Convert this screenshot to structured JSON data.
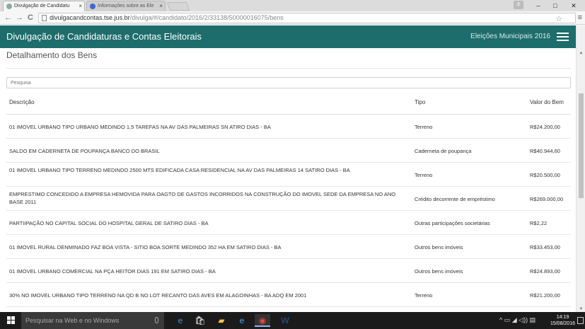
{
  "browser": {
    "tabs": [
      {
        "title": "Divulgação de Candidatu",
        "state": "active",
        "favicon_color": "#8aa"
      },
      {
        "title": "Informações sobre as Ele",
        "state": "inactive",
        "favicon_color": "#3b6cc7"
      }
    ],
    "url_host": "divulgacandcontas.tse.jus.br",
    "url_path": "/divulga/#/candidato/2016/2/33138/50000016075/bens",
    "back_glyph": "←",
    "forward_glyph": "→",
    "reload_glyph": "C",
    "star_glyph": "☆",
    "menu_glyph": "≡",
    "profile_glyph": "≗",
    "minimize_glyph": "–",
    "maximize_glyph": "□",
    "close_glyph": "✕"
  },
  "app": {
    "title": "Divulgação de Candidaturas e Contas Eleitorais",
    "election": "Eleições Municipais 2016",
    "header_color": "#1e6d6d"
  },
  "page": {
    "title": "Detalhamento dos Bens",
    "search_placeholder": "Pesquisa"
  },
  "table": {
    "headers": {
      "descricao": "Descrição",
      "tipo": "Tipo",
      "valor": "Valor do Bem"
    },
    "rows": [
      {
        "descricao": "01 IMOVEL URBANO TIPO URBANO MEDINDO 1,5 TAREFAS NA AV DAS PALMEIRAS SN ATIRO DIAS - BA",
        "tipo": "Terreno",
        "valor": "R$24.200,00"
      },
      {
        "descricao": "SALDO EM CADERNETA DE POUPANÇA BANCO DO BRASIL",
        "tipo": "Caderneta de poupança",
        "valor": "R$40.944,60"
      },
      {
        "descricao": "01 IMOVEL URBANO TIPO TERRENO MEDINDO 2500 MTS EDIFICADA CASA RESIDENCIAL NA AV DAS PALMEIRAS 14 SATIRO DIAS - BA",
        "tipo": "Terreno",
        "valor": "R$20.500,00"
      },
      {
        "descricao": "EMPRESTIMO CONCEDIDO A EMPRESA HEMOVIDA PARA OAGTO DE GASTOS INCORRIDOS NA CONSTRUÇÃO DO IMOVEL SEDE DA EMPRESA NO ANO BASE 2011",
        "tipo": "Crédito decorrente de empréstimo",
        "valor": "R$269.000,00"
      },
      {
        "descricao": "PARTIIPAÇÃO NO CAPITAL SOCIAL DO HOSPITAL GERAL DE SATIRO DIAS - BA",
        "tipo": "Outras participações societárias",
        "valor": "R$2,22"
      },
      {
        "descricao": "01 IMOVEL RURAL DENMINADO FAZ BOA VISTA - SITIO BOA SORTE MEDINDO 352 HA EM SATIRO DIAS - BA",
        "tipo": "Outros bens imóveis",
        "valor": "R$33.453,00"
      },
      {
        "descricao": "01 IMOVEL URBANO COMERCIAL NA PÇA HEITOR DIAS 191 EM SATIRO DIAS - BA",
        "tipo": "Outros bens imóveis",
        "valor": "R$24.893,00"
      },
      {
        "descricao": "30% NO IMOVEL URBANO TIPO TERRENO NA QD B NO LOT RECANTO DAS AVES EM ALAGOINHAS - BA ADQ EM 2001",
        "tipo": "Terreno",
        "valor": "R$21.200,00"
      }
    ]
  },
  "taskbar": {
    "search_placeholder": "Pesquisar na Web e no Windows",
    "icons": [
      {
        "name": "edge-icon",
        "glyph": "e",
        "color": "#3a8ee6"
      },
      {
        "name": "store-icon",
        "glyph": "🛍",
        "color": "#ffffff"
      },
      {
        "name": "file-explorer-icon",
        "glyph": "▰",
        "color": "#f5c242"
      },
      {
        "name": "internet-explorer-icon",
        "glyph": "e",
        "color": "#3fa9f5"
      },
      {
        "name": "chrome-icon",
        "glyph": "◉",
        "color": "#e8453c"
      },
      {
        "name": "word-icon",
        "glyph": "W",
        "color": "#2b5797"
      }
    ],
    "tray_glyphs": "^ ▭ ◢ ◁)) ▤",
    "time": "14:19",
    "date": "15/08/2016"
  }
}
